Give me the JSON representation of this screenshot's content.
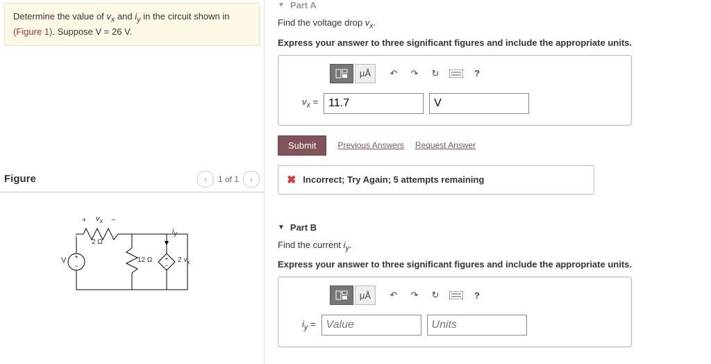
{
  "prompt": {
    "line1_pre": "Determine the value of ",
    "vx": "v",
    "vx_sub": "x",
    "line1_mid": " and ",
    "iy": "i",
    "iy_sub": "y",
    "line1_post": " in the circuit shown in",
    "fig_link": "(Figure 1)",
    "suppose": ". Suppose ",
    "v_eq": "V = 26 V."
  },
  "figure": {
    "title": "Figure",
    "pager": "1 of 1",
    "labels": {
      "plus": "+",
      "minus": "−",
      "vx": "v",
      "vx_sub": "x",
      "iy": "i",
      "iy_sub": "y",
      "r1": "2 Ω",
      "r2": "12 Ω",
      "src": "V",
      "dep": "2 v",
      "dep_sub": "x"
    }
  },
  "partA": {
    "header": "Part A",
    "find_pre": "Find the voltage drop ",
    "find_sym": "v",
    "find_sub": "x",
    "find_post": ".",
    "express": "Express your answer to three significant figures and include the appropriate units.",
    "toolbar": {
      "units": "μÅ",
      "help": "?"
    },
    "lhs_sym": "v",
    "lhs_sub": "x",
    "lhs_eq": " = ",
    "value": "11.7",
    "unit": "V",
    "submit": "Submit",
    "prev": "Previous Answers",
    "req": "Request Answer",
    "feedback": "Incorrect; Try Again; 5 attempts remaining"
  },
  "partB": {
    "header": "Part B",
    "find_pre": "Find the current ",
    "find_sym": "i",
    "find_sub": "y",
    "find_post": ".",
    "express": "Express your answer to three significant figures and include the appropriate units.",
    "toolbar": {
      "units": "μÅ",
      "help": "?"
    },
    "lhs_sym": "i",
    "lhs_sub": "y",
    "lhs_eq": " = ",
    "value_ph": "Value",
    "unit_ph": "Units"
  }
}
